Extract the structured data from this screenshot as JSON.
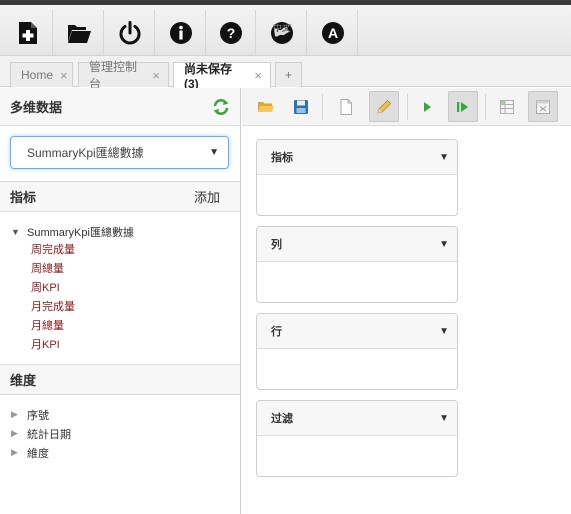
{
  "topbar": {
    "buttons": [
      {
        "name": "new-query-icon"
      },
      {
        "name": "open-folder-icon"
      },
      {
        "name": "power-icon"
      },
      {
        "name": "info-icon"
      },
      {
        "name": "help-icon"
      },
      {
        "name": "language-globe-icon",
        "label": "中文"
      },
      {
        "name": "about-a-icon",
        "label": "A"
      }
    ]
  },
  "tabs": [
    {
      "label": "Home",
      "close": "×"
    },
    {
      "label": "管理控制台",
      "close": "×"
    },
    {
      "label": "尚未保存 (3)",
      "close": "×"
    },
    {
      "label": "+"
    }
  ],
  "left": {
    "title": "多维数据",
    "cube_select": {
      "value": "SummaryKpi匯總數據",
      "caret": "▼"
    },
    "measures": {
      "title": "指标",
      "add_label": "添加",
      "root": {
        "arrow": "▼",
        "label": "SummaryKpi匯總數據"
      },
      "items": [
        "周完成量",
        "周總量",
        "周KPI",
        "月完成量",
        "月總量",
        "月KPI"
      ]
    },
    "dimensions": {
      "title": "维度",
      "items": [
        {
          "arrow": "▶",
          "label": "序號"
        },
        {
          "arrow": "▶",
          "label": "統計日期"
        },
        {
          "arrow": "▶",
          "label": "維度"
        }
      ]
    }
  },
  "zones": [
    {
      "title": "指标",
      "caret": "▼"
    },
    {
      "title": "列",
      "caret": "▼"
    },
    {
      "title": "行",
      "caret": "▼"
    },
    {
      "title": "过滤",
      "caret": "▼"
    }
  ],
  "colors": {
    "accent_green": "#3aa53a",
    "measure_red": "#8b1a1a",
    "select_focus": "#66afe9"
  }
}
